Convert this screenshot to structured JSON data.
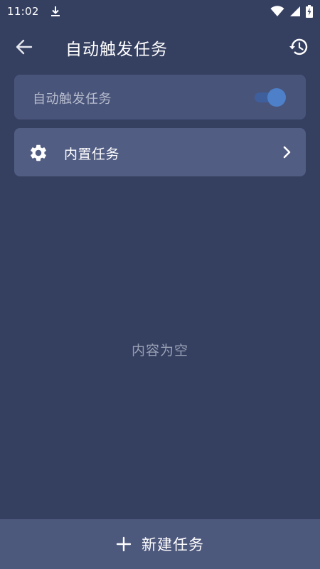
{
  "status_bar": {
    "time": "11:02",
    "icons": [
      "download-icon",
      "wifi-icon",
      "signal-icon",
      "battery-charging-icon"
    ]
  },
  "app_bar": {
    "title": "自动触发任务",
    "back_icon": "arrow-left-icon",
    "history_icon": "history-icon"
  },
  "toggle_card": {
    "label": "自动触发任务",
    "enabled": true
  },
  "builtin_card": {
    "label": "内置任务",
    "icon": "gear-icon",
    "chevron_icon": "chevron-right-icon"
  },
  "empty_state": {
    "text": "内容为空"
  },
  "bottom_action": {
    "label": "新建任务",
    "icon": "plus-icon"
  },
  "colors": {
    "background": "#353f60",
    "card_toggle": "#49547a",
    "card_builtin": "#525d83",
    "switch_thumb": "#4d80c9",
    "bottom_bar": "#4d587d"
  }
}
